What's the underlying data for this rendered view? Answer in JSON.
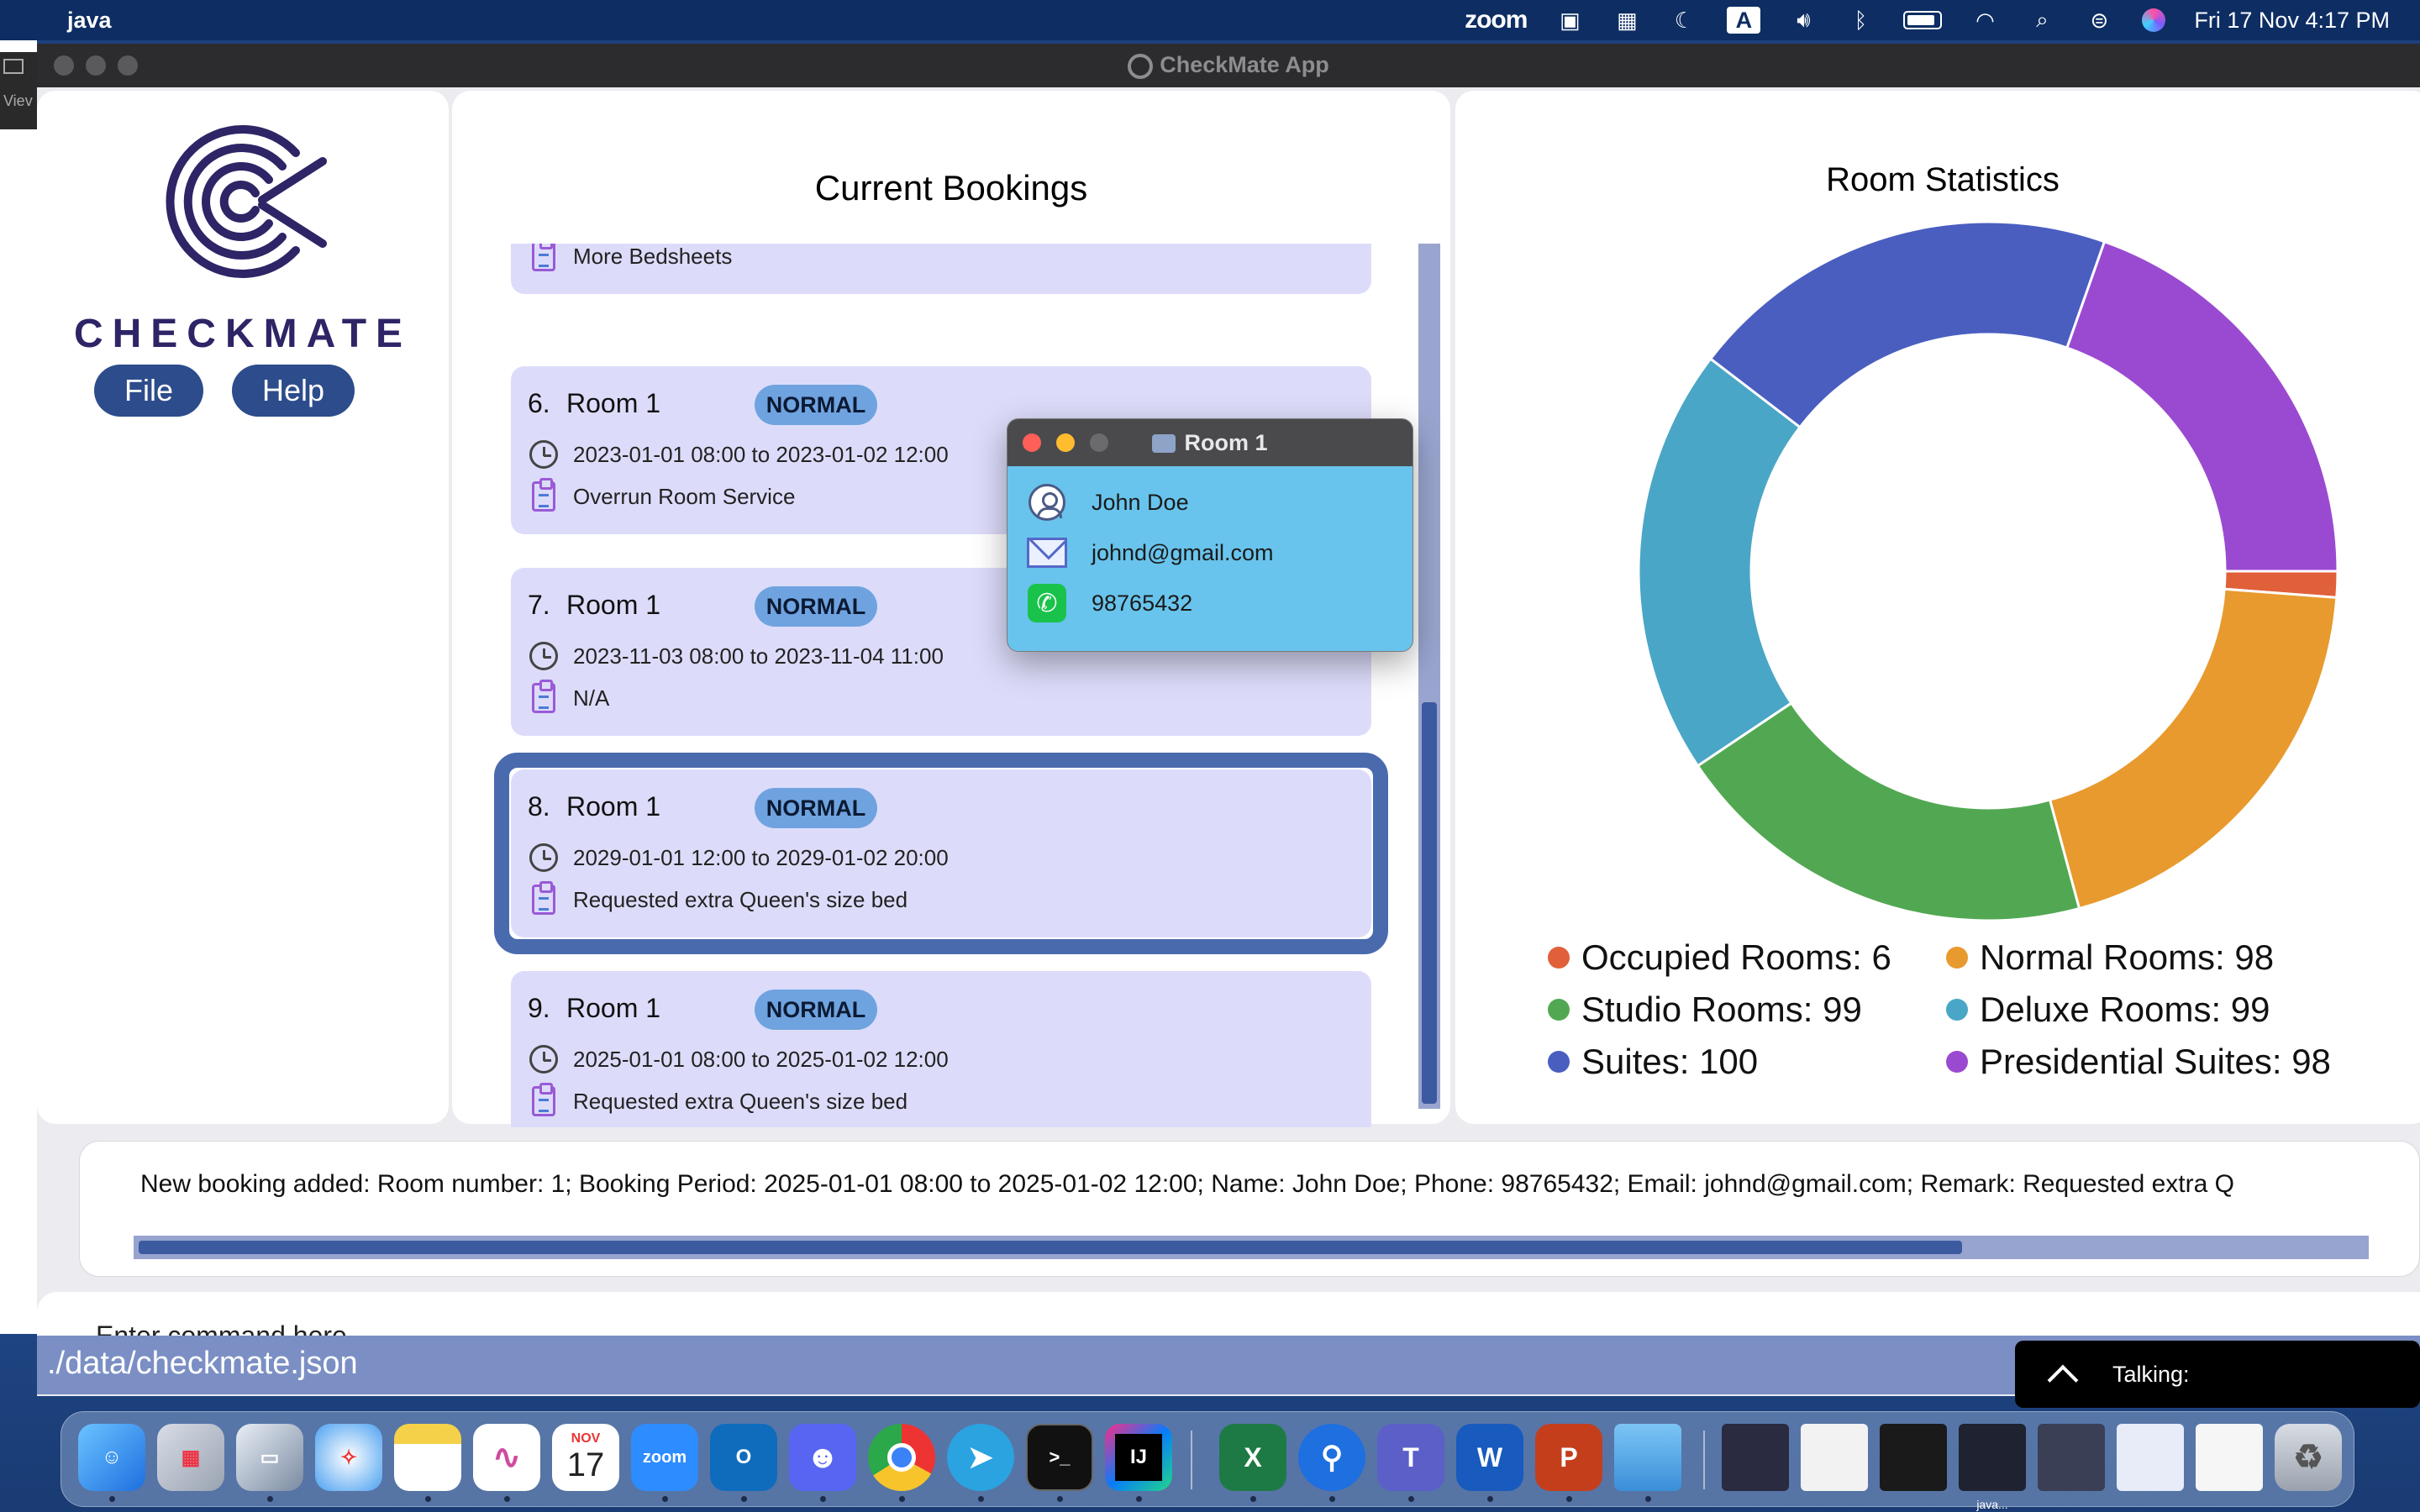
{
  "menubar": {
    "app_name": "java",
    "zoom_label": "zoom",
    "input_source": "A",
    "datetime": "Fri 17 Nov  4:17 PM"
  },
  "sliver": {
    "label": "Viev"
  },
  "window": {
    "title": "CheckMate App"
  },
  "logo": {
    "word": "CHECKMATE"
  },
  "menu": {
    "file_label": "File",
    "help_label": "Help"
  },
  "bookings": {
    "title": "Current Bookings",
    "partial_remark": "More Bedsheets",
    "items": [
      {
        "index": "6.",
        "room": "Room 1",
        "type": "NORMAL",
        "period": "2023-01-01 08:00 to 2023-01-02 12:00",
        "remark": "Overrun Room Service"
      },
      {
        "index": "7.",
        "room": "Room 1",
        "type": "NORMAL",
        "period": "2023-11-03 08:00 to 2023-11-04 11:00",
        "remark": "N/A"
      },
      {
        "index": "8.",
        "room": "Room 1",
        "type": "NORMAL",
        "period": "2029-01-01 12:00 to 2029-01-02 20:00",
        "remark": "Requested extra Queen's size bed"
      },
      {
        "index": "9.",
        "room": "Room 1",
        "type": "NORMAL",
        "period": "2025-01-01 08:00 to 2025-01-02 12:00",
        "remark": "Requested extra Queen's size bed"
      }
    ]
  },
  "popup": {
    "title": "Room 1",
    "name": "John Doe",
    "email": "johnd@gmail.com",
    "phone": "98765432"
  },
  "stats": {
    "title": "Room Statistics",
    "legend": [
      {
        "label": "Occupied Rooms: 6",
        "color": "#e0603a"
      },
      {
        "label": "Normal Rooms: 98",
        "color": "#e89a2e"
      },
      {
        "label": "Studio Rooms: 99",
        "color": "#52a852"
      },
      {
        "label": "Deluxe Rooms: 99",
        "color": "#4aa6c6"
      },
      {
        "label": "Suites: 100",
        "color": "#4a5ec0"
      },
      {
        "label": "Presidential Suites: 98",
        "color": "#9a4ad0"
      }
    ]
  },
  "chart_data": {
    "type": "pie",
    "categories": [
      "Occupied Rooms",
      "Normal Rooms",
      "Studio Rooms",
      "Deluxe Rooms",
      "Suites",
      "Presidential Suites"
    ],
    "values": [
      6,
      98,
      99,
      99,
      100,
      98
    ],
    "colors": [
      "#e0603a",
      "#e89a2e",
      "#52a852",
      "#4aa6c6",
      "#4a5ec0",
      "#9a4ad0"
    ],
    "title": "Room Statistics",
    "donut": true,
    "legend_position": "bottom"
  },
  "result": {
    "text": "New booking added: Room number: 1; Booking Period: 2025-01-01 08:00 to 2025-01-02 12:00; Name: John Doe; Phone: 98765432; Email: johnd@gmail.com; Remark: Requested extra Q"
  },
  "command": {
    "placeholder": "Enter command here..."
  },
  "status": {
    "path": "./data/checkmate.json"
  },
  "talking": {
    "label": "Talking:"
  },
  "dock": {
    "calendar_month": "NOV",
    "calendar_day": "17",
    "zoom_label": "zoom",
    "intellij_label": "IJ",
    "excel_label": "X",
    "teams_label": "T",
    "word_label": "W",
    "powerpoint_label": "P",
    "outlook_label": "O",
    "terminal_label": ">_",
    "window_label": "java..."
  }
}
